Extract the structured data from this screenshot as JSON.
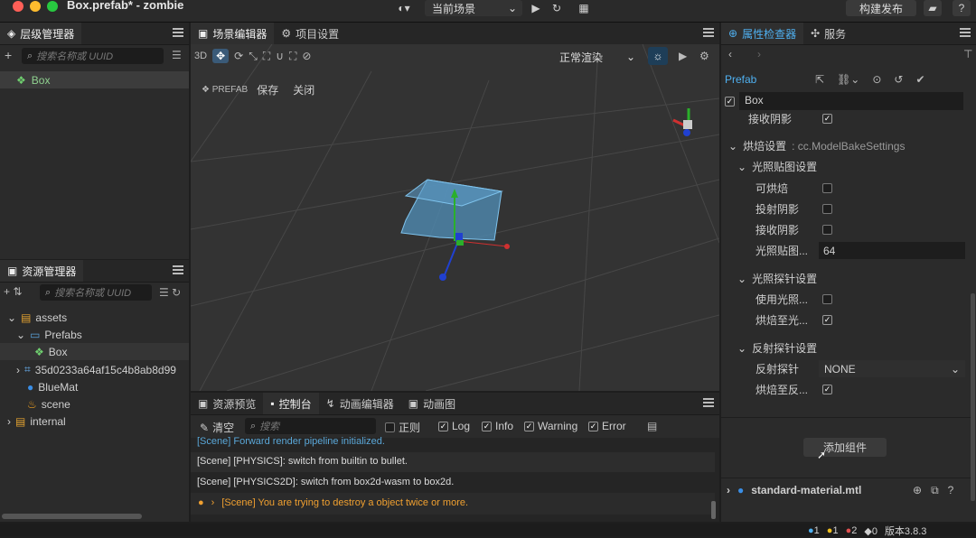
{
  "titlebar": {
    "title": "Box.prefab* - zombie",
    "scene_select": "当前场景",
    "publish": "构建发布"
  },
  "hierarchy": {
    "tab": "层级管理器",
    "search_placeholder": "搜索名称或 UUID",
    "items": [
      {
        "label": "Box"
      }
    ]
  },
  "assets": {
    "tab": "资源管理器",
    "search_placeholder": "搜索名称或 UUID",
    "items": [
      {
        "label": "assets"
      },
      {
        "label": "Prefabs"
      },
      {
        "label": "Box"
      },
      {
        "label": "35d0233a64af15c4b8ab8d99"
      },
      {
        "label": "BlueMat"
      },
      {
        "label": "scene"
      },
      {
        "label": "internal"
      }
    ]
  },
  "scene": {
    "tabs": [
      {
        "label": "场景编辑器"
      },
      {
        "label": "项目设置"
      }
    ],
    "tool_3d": "3D",
    "render_mode": "正常渲染",
    "prefab_label": "PREFAB",
    "save": "保存",
    "close": "关闭"
  },
  "console": {
    "tabs": [
      {
        "label": "资源预览"
      },
      {
        "label": "控制台"
      },
      {
        "label": "动画编辑器"
      },
      {
        "label": "动画图"
      }
    ],
    "clear": "清空",
    "search_placeholder": "搜索",
    "filters": {
      "regex": "正则",
      "log": "Log",
      "info": "Info",
      "warning": "Warning",
      "error": "Error"
    },
    "lines": [
      "[Scene] Forward render pipeline initialized.",
      "[Scene] [PHYSICS]: switch from builtin to bullet.",
      "[Scene] [PHYSICS2D]: switch from box2d-wasm to box2d.",
      "[Scene] You are trying to destroy a object twice or more."
    ]
  },
  "inspector": {
    "tabs": [
      {
        "label": "属性检查器"
      },
      {
        "label": "服务"
      }
    ],
    "prefab": "Prefab",
    "node_name": "Box",
    "receive_shadow_top": "接收阴影",
    "bake_settings": "烘焙设置",
    "bake_type": ": cc.ModelBakeSettings",
    "lightmap_group": "光照贴图设置",
    "bakeable": "可烘焙",
    "cast_shadow": "投射阴影",
    "receive_shadow": "接收阴影",
    "lightmap_size_label": "光照贴图...",
    "lightmap_size": "64",
    "probe_group": "光照探针设置",
    "use_probe": "使用光照...",
    "bake_to_probe": "烘焙至光...",
    "reflection_group": "反射探针设置",
    "reflection_probe_label": "反射探针",
    "reflection_probe_value": "NONE",
    "bake_to_reflection": "烘焙至反...",
    "add_component": "添加组件",
    "material": "standard-material.mtl"
  },
  "statusbar": {
    "info_count": "1",
    "warn_count": "1",
    "error_count": "2",
    "other_count": "0",
    "version": "版本3.8.3"
  }
}
